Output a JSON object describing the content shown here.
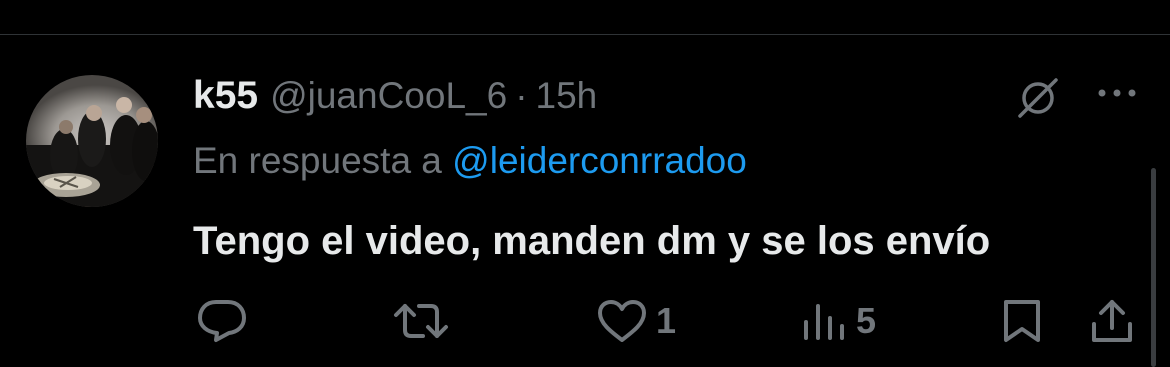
{
  "tweet": {
    "display_name": "k55",
    "handle": "@juanCooL_6",
    "separator": "·",
    "time": "15h",
    "reply_prefix": "En respuesta a",
    "reply_mention": "@leiderconrradoo",
    "text": "Tengo el video, manden dm y se los envío"
  },
  "actions": {
    "reply_count": "",
    "retweet_count": "",
    "like_count": "1",
    "views_count": "5"
  },
  "icons": {
    "grok": "grok-icon",
    "more": "more-icon",
    "reply": "reply-icon",
    "retweet": "retweet-icon",
    "like": "heart-icon",
    "views": "views-icon",
    "bookmark": "bookmark-icon",
    "share": "share-icon"
  },
  "colors": {
    "background": "#000000",
    "text_primary": "#e7e9ea",
    "text_secondary": "#71767b",
    "accent": "#1d9bf0"
  }
}
